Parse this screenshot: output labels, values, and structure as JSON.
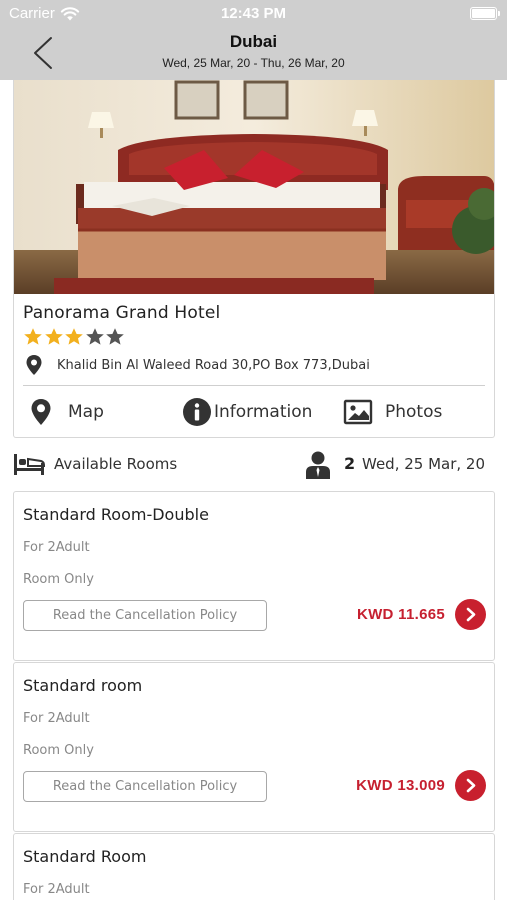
{
  "status_bar": {
    "carrier": "Carrier",
    "time": "12:43 PM"
  },
  "header": {
    "title": "Dubai",
    "subtitle": "Wed, 25 Mar, 20 - Thu, 26 Mar, 20"
  },
  "hotel": {
    "name": "Panorama Grand Hotel",
    "rating": 3,
    "max_rating": 5,
    "address": "Khalid Bin Al Waleed Road 30,PO Box 773,Dubai",
    "actions": {
      "map": "Map",
      "information": "Information",
      "photos": "Photos"
    }
  },
  "availability": {
    "label": "Available Rooms",
    "guests": "2",
    "date": "Wed, 25 Mar, 20"
  },
  "rooms": [
    {
      "title": "Standard Room-Double",
      "occupancy": "For 2Adult",
      "board": "Room Only",
      "cancel_label": "Read the Cancellation Policy",
      "price": "KWD 11.665"
    },
    {
      "title": "Standard room",
      "occupancy": "For 2Adult",
      "board": "Room Only",
      "cancel_label": "Read the Cancellation Policy",
      "price": "KWD 13.009"
    },
    {
      "title": "Standard Room",
      "occupancy": "For 2Adult",
      "board": "",
      "cancel_label": "",
      "price": ""
    }
  ],
  "colors": {
    "header_bg": "#cfcfcf",
    "accent": "#c8202e",
    "star_filled": "#f2b01e",
    "star_empty": "#555555"
  }
}
